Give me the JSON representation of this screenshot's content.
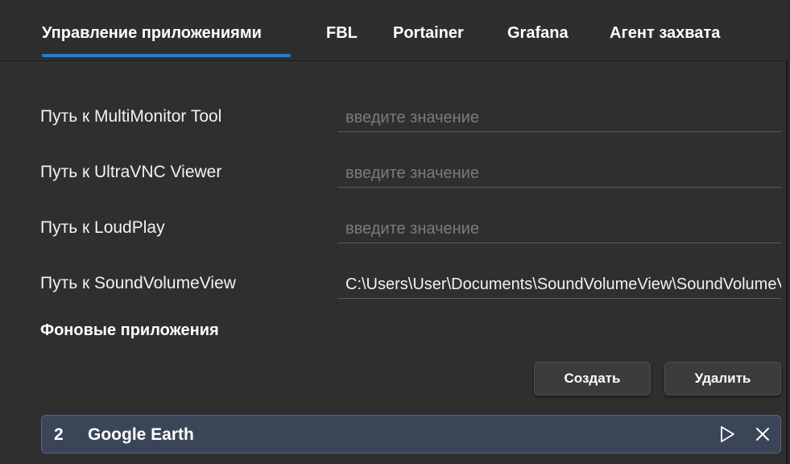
{
  "tabs": [
    {
      "label": "Управление приложениями",
      "active": true
    },
    {
      "label": "FBL",
      "active": false
    },
    {
      "label": "Portainer",
      "active": false
    },
    {
      "label": "Grafana",
      "active": false
    },
    {
      "label": "Агент захвата",
      "active": false
    }
  ],
  "fields": [
    {
      "label": "Путь к MultiMonitor Tool",
      "value": "",
      "placeholder": "введите значение"
    },
    {
      "label": "Путь к UltraVNC Viewer",
      "value": "",
      "placeholder": "введите значение"
    },
    {
      "label": "Путь к LoudPlay",
      "value": "",
      "placeholder": "введите значение"
    },
    {
      "label": "Путь к SoundVolumeView",
      "value": "C:\\Users\\User\\Documents\\SoundVolumeView\\SoundVolumeView.exe",
      "placeholder": "введите значение"
    }
  ],
  "background_apps": {
    "title": "Фоновые приложения",
    "create_label": "Создать",
    "delete_label": "Удалить",
    "items": [
      {
        "number": "2",
        "name": "Google Earth"
      }
    ]
  },
  "icons": {
    "play": "play-icon",
    "close": "close-icon"
  },
  "colors": {
    "accent": "#1e7fe0",
    "row_background": "#3a4658"
  }
}
